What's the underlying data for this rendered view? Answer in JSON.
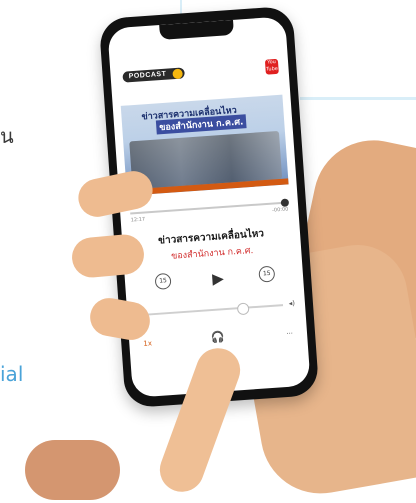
{
  "background_text": {
    "top": "น",
    "bottom": "ial"
  },
  "app": {
    "badge": "PODCAST",
    "youtube_label": "You Tube",
    "banner": {
      "line1": "ข่าวสารความเคลื่อนไหว",
      "line2": "ของสำนักงาน ก.ค.ศ."
    },
    "player": {
      "title": "ข่าวสารความเคลื่อนไหว",
      "subtitle": "ของสำนักงาน ก.ค.ศ.",
      "time_elapsed": "12:17",
      "time_total": "-00:00",
      "rewind_label": "15",
      "forward_label": "15",
      "speed_label": "1x",
      "more_label": "···",
      "progress": 0.98,
      "volume": 0.7
    }
  },
  "colors": {
    "accent_red": "#d12b2b",
    "banner_blue": "#3b4ea0",
    "mic_yellow": "#f5b70f"
  },
  "icons": {
    "mic": "microphone-icon",
    "youtube": "youtube-icon",
    "play": "play-icon",
    "rewind": "rewind-15-icon",
    "forward": "forward-15-icon",
    "headphones": "headphones-icon"
  }
}
